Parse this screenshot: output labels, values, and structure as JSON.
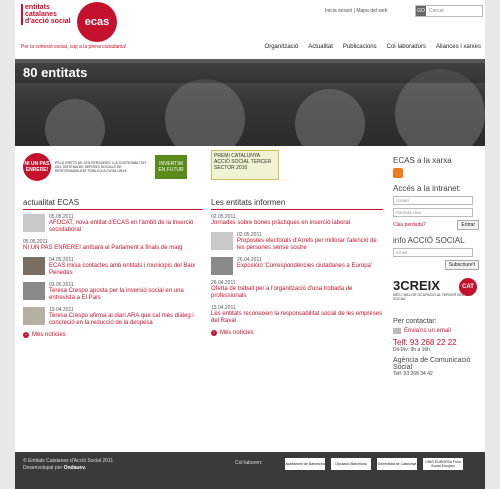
{
  "header": {
    "logo_text": "entitats catalanes d'acció social",
    "logo_mark": "ecas",
    "tagline": "Per la cohesió social, cap a la plena ciutadania!",
    "login": "Inicia sessió",
    "sitemap": "Mapa del web",
    "search_go": "GO",
    "search_placeholder": "Cercar"
  },
  "nav": [
    "Organització",
    "Actualitat",
    "Publicacions",
    "Col·laboradors",
    "Aliances i xarxes"
  ],
  "hero": {
    "title": "80 entitats"
  },
  "ads": {
    "a1_red": "NI UN PAS ENRERE!",
    "a1_text": "PELS DRETS DE LES PERSONES I LA SOSTENIBILITAT DEL SISTEMA DE SERVEIS SOCIALS DE RESPONSABILITAT PÚBLICA A CATALUNYA",
    "a1_green": "INVERTIM EN FUTUR",
    "a2": "PREMI CATALUNYA ACCIÓ SOCIAL TERCER SECTOR 2010"
  },
  "news_ecas": {
    "title": "actualitat ECAS",
    "items": [
      {
        "date": "05.05.2011",
        "title": "AFOCAT, nova entitat d'ECAS en l'àmbit de la inserció sociolaboral"
      },
      {
        "date": "05.05.2011",
        "title": "NI UN PAS ENRERE! arribarà al Parlament a finals de maig"
      },
      {
        "date": "04.05.2011",
        "title": "ECAS inicia contactes amb entitats i municipis del Baix Penedès"
      },
      {
        "date": "03.05.2011",
        "title": "Teresa Crespo aposta per la inversió social en una entrevista a El País"
      },
      {
        "date": "19.04.2011",
        "title": "Teresa Crespo afirma al diari ARA que cal més diàleg i concreció en la reducció de la despesa"
      }
    ],
    "more": "Més notícies"
  },
  "news_entitats": {
    "title": "Les entitats informen",
    "items": [
      {
        "date": "02.05.2011",
        "title": "Jornades sobre bones pràctiques en inserció laboral"
      },
      {
        "date": "02.05.2011",
        "title": "Propostes electorals d'Arrels per millorar l'atenció de les persones sense sostre"
      },
      {
        "date": "26.04.2011",
        "title": "Exposició 'Correspondències ciutadanes a Europa'"
      },
      {
        "date": "26.04.2011",
        "title": "Oferta de treball per a l'organització d'una trobada de professionals"
      },
      {
        "date": "15.04.2011",
        "title": "Les entitats reconeixen la responsabilitat social de les empreses del Raval"
      }
    ],
    "more": "Més notícies"
  },
  "sidebar": {
    "xarxa": "ECAS a la xarxa",
    "intranet": "Accés a la intranet:",
    "user_placeholder": "Usuari",
    "pass_placeholder": "Paraula clau",
    "forgot": "Clau perduda?",
    "enter": "Entrar",
    "info": "info ACCIÓ SOCIAL",
    "email_placeholder": "Email",
    "subscribe": "Subscriure't",
    "creix_big": "3CREIX",
    "creix_cat": "CAT",
    "creix_sub": "MÉS I MILLOR OCUPACIÓ AL TERCER SECTOR SOCIAL",
    "contact_title": "Per contactar:",
    "email_link": "Envia'ns un email",
    "phone": "Telf: 93 268 22 22",
    "hours": "Dil-Div: 9h a 16h",
    "agency": "Agència de Comunicació Social",
    "agency_phone": "Telf: 93 268 34 42"
  },
  "footer": {
    "copyright": "© Entitats Catalanes d'Acció Social 2011",
    "dev": "Desenvolupat per",
    "dev_by": "Ondauev.",
    "collab": "Col·laboren:",
    "logos": [
      "Ajuntament de Barcelona",
      "Diputació Barcelona",
      "Generalitat de Catalunya",
      "UNIÓ EUROPEA Fons Social Europeu"
    ]
  }
}
